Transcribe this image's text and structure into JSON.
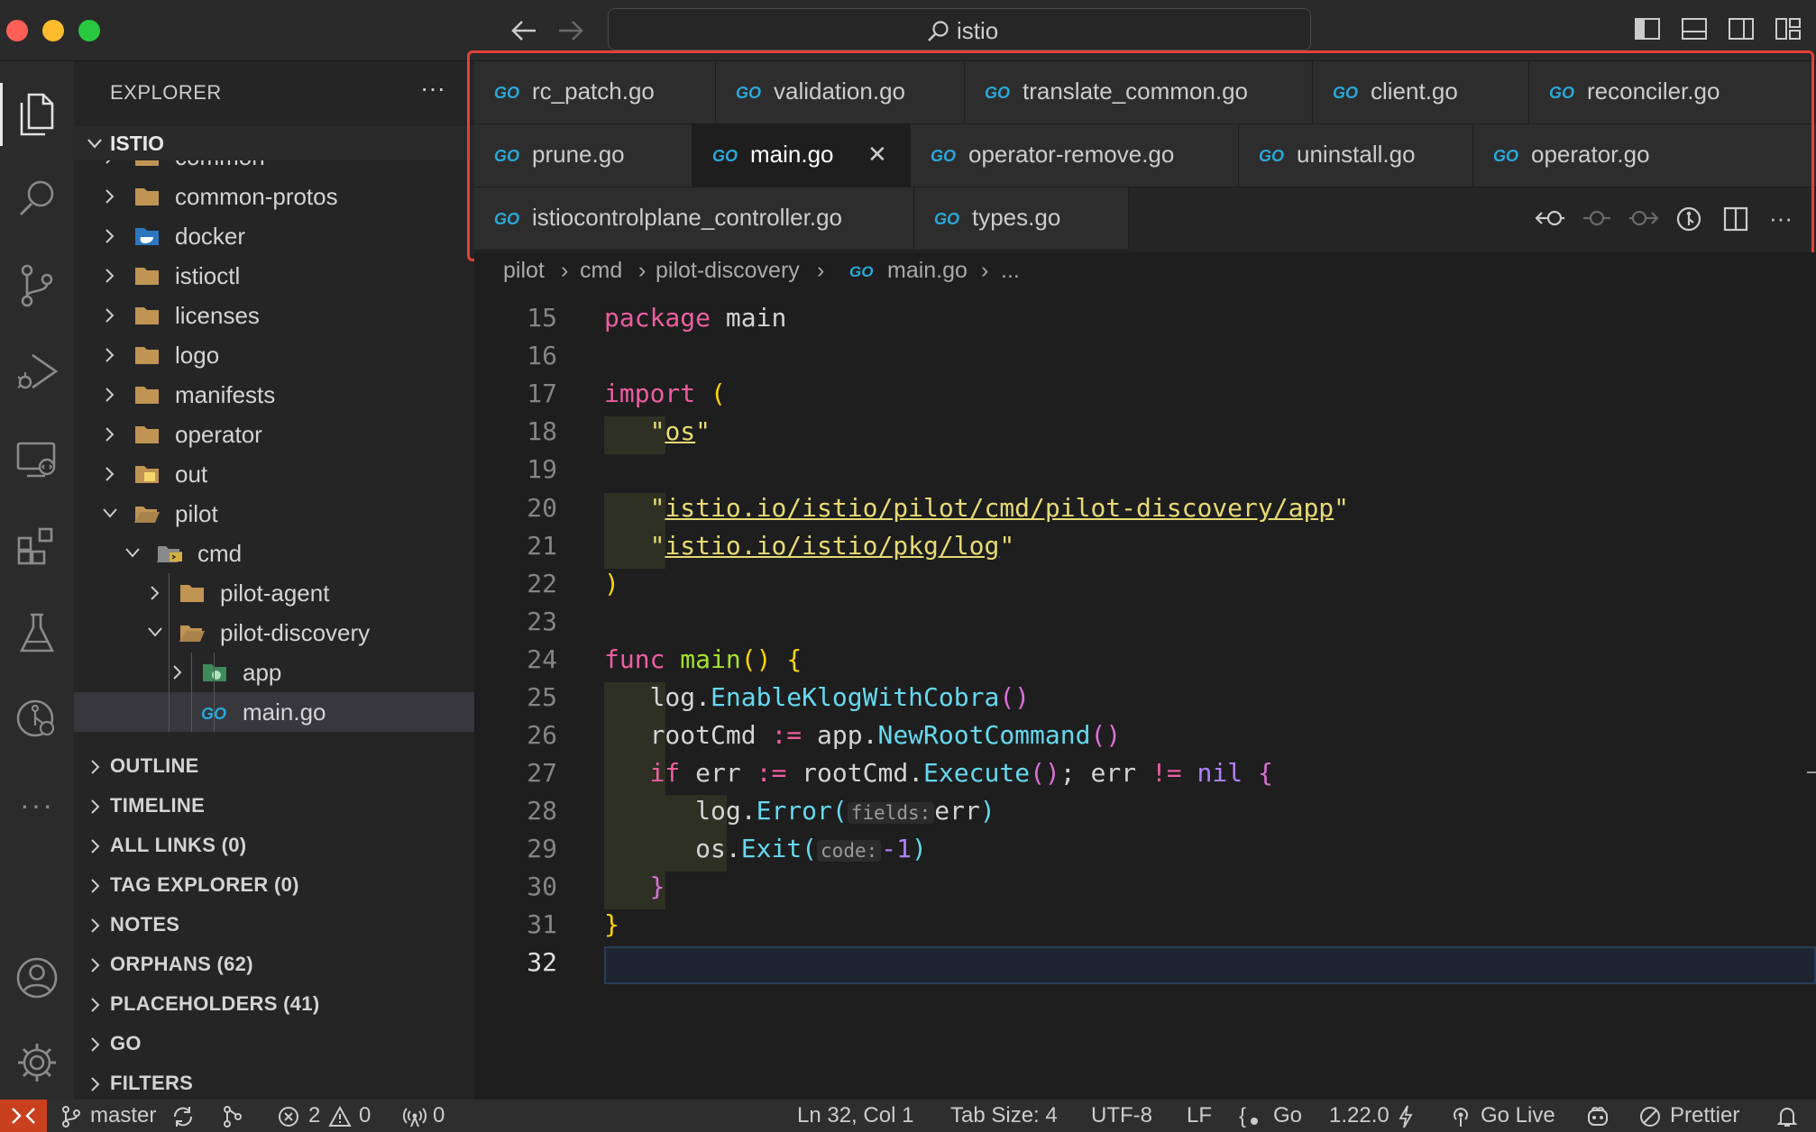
{
  "title_bar": {
    "search_text": "istio"
  },
  "activity_bar": {
    "more": "···"
  },
  "sidebar": {
    "title": "EXPLORER",
    "more": "···",
    "root": "ISTIO",
    "tree": [
      {
        "label": "common",
        "depth": 1,
        "open": false,
        "kind": "folder"
      },
      {
        "label": "common-protos",
        "depth": 1,
        "open": false,
        "kind": "folder"
      },
      {
        "label": "docker",
        "depth": 1,
        "open": false,
        "kind": "docker"
      },
      {
        "label": "istioctl",
        "depth": 1,
        "open": false,
        "kind": "folder"
      },
      {
        "label": "licenses",
        "depth": 1,
        "open": false,
        "kind": "folder"
      },
      {
        "label": "logo",
        "depth": 1,
        "open": false,
        "kind": "folder"
      },
      {
        "label": "manifests",
        "depth": 1,
        "open": false,
        "kind": "folder"
      },
      {
        "label": "operator",
        "depth": 1,
        "open": false,
        "kind": "folder"
      },
      {
        "label": "out",
        "depth": 1,
        "open": false,
        "kind": "out"
      },
      {
        "label": "pilot",
        "depth": 1,
        "open": true,
        "kind": "folder-open"
      },
      {
        "label": "cmd",
        "depth": 2,
        "open": true,
        "kind": "cmd"
      },
      {
        "label": "pilot-agent",
        "depth": 3,
        "open": false,
        "kind": "folder"
      },
      {
        "label": "pilot-discovery",
        "depth": 3,
        "open": true,
        "kind": "folder-open"
      },
      {
        "label": "app",
        "depth": 4,
        "open": false,
        "kind": "app"
      },
      {
        "label": "main.go",
        "depth": 4,
        "open": null,
        "kind": "go"
      }
    ],
    "sections": [
      "OUTLINE",
      "TIMELINE",
      "ALL LINKS (0)",
      "TAG EXPLORER (0)",
      "NOTES",
      "ORPHANS (62)",
      "PLACEHOLDERS (41)",
      "GO",
      "FILTERS"
    ]
  },
  "tabs": {
    "rows": [
      [
        "rc_patch.go",
        "validation.go",
        "translate_common.go",
        "client.go",
        "reconciler.go"
      ],
      [
        "prune.go",
        "main.go",
        "operator-remove.go",
        "uninstall.go",
        "operator.go"
      ],
      [
        "istiocontrolplane_controller.go",
        "types.go"
      ]
    ],
    "active": "main.go",
    "close_glyph": "✕",
    "more": "···"
  },
  "breadcrumb": [
    "pilot",
    "cmd",
    "pilot-discovery",
    "main.go",
    "..."
  ],
  "editor": {
    "line_numbers": [
      "15",
      "16",
      "17",
      "18",
      "19",
      "20",
      "21",
      "22",
      "23",
      "24",
      "25",
      "26",
      "27",
      "28",
      "29",
      "30",
      "31",
      "32"
    ],
    "current_line": "32",
    "lines": {
      "l15_kw": "package",
      "l15_name": "main",
      "l17_kw": "import",
      "l17_paren": "(",
      "l18_str": "os",
      "l20_str": "istio.io/istio/pilot/cmd/pilot-discovery/app",
      "l21_str": "istio.io/istio/pkg/log",
      "l22_paren": ")",
      "l24_kw": "func",
      "l24_fn": "main",
      "l25_pkg": "log",
      "l25_fn": "EnableKlogWithCobra",
      "l26_var": "rootCmd",
      "l26_op": ":=",
      "l26_pkg": "app",
      "l26_fn": "NewRootCommand",
      "l27_kw": "if",
      "l27_var": "err",
      "l27_op": ":=",
      "l27_obj": "rootCmd",
      "l27_fn": "Execute",
      "l27_var2": "err",
      "l27_op2": "!=",
      "l27_nil": "nil",
      "l28_pkg": "log",
      "l28_fn": "Error",
      "l28_hint": "fields:",
      "l28_arg": "err",
      "l29_pkg": "os",
      "l29_fn": "Exit",
      "l29_hint": "code:",
      "l29_num": "-1",
      "l30_brace": "}",
      "l31_brace": "}"
    }
  },
  "status_bar": {
    "branch": "master",
    "errors": "2",
    "warnings": "0",
    "ports": "0",
    "position": "Ln 32, Col 1",
    "tab_size": "Tab Size: 4",
    "encoding": "UTF-8",
    "eol": "LF",
    "language": "Go",
    "go_version": "1.22.0",
    "go_live": "Go Live",
    "prettier": "Prettier"
  },
  "colors": {
    "accent_red": "#e5403a",
    "go_blue": "#29a9d9",
    "folder": "#c09553",
    "remote": "#c8401e"
  }
}
